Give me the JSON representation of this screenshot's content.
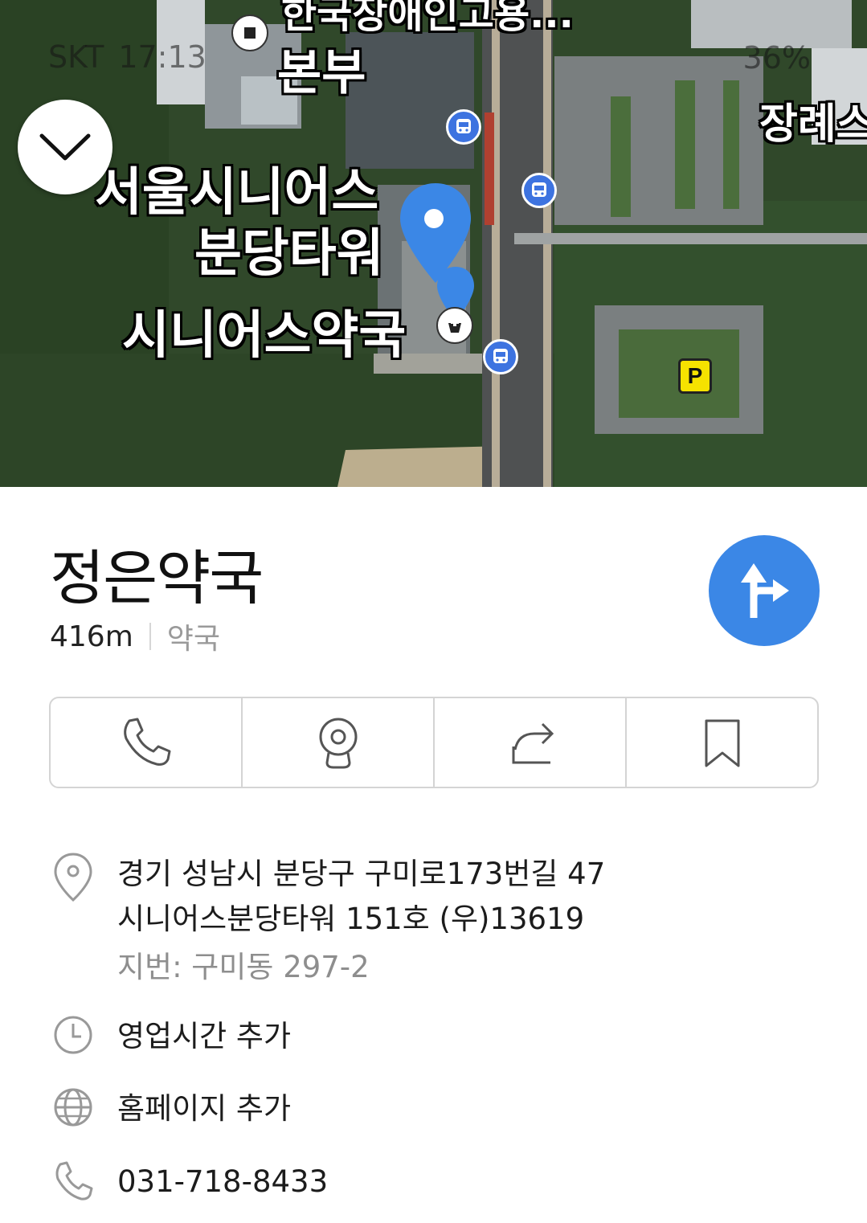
{
  "status_bar": {
    "carrier": "SKT",
    "time": "17:13",
    "battery": "36%"
  },
  "map": {
    "labels": {
      "top_partial": "한국장애인고용...",
      "headquarters": "본부",
      "funeral_partial": "장례스",
      "senior_tower_line1": "서울시니어스",
      "senior_tower_line2": "분당타워",
      "senior_pharmacy": "시니어스약국"
    },
    "parking_label": "P",
    "colors": {
      "pin": "#3b87e6",
      "bus_stop": "#3d73e0",
      "parking": "#f6e200"
    }
  },
  "place": {
    "name": "정은약국",
    "distance": "416m",
    "category": "약국"
  },
  "actions": [
    {
      "icon": "phone-icon"
    },
    {
      "icon": "street-view-icon"
    },
    {
      "icon": "share-icon"
    },
    {
      "icon": "bookmark-icon"
    }
  ],
  "info": {
    "address_line1": "경기 성남시 분당구 구미로173번길 47",
    "address_line2": "시니어스분당타워 151호 (우)13619",
    "lot_number": "지번: 구미동 297-2",
    "hours_link": "영업시간 추가",
    "homepage_link": "홈페이지 추가",
    "phone": "031-718-8433"
  }
}
